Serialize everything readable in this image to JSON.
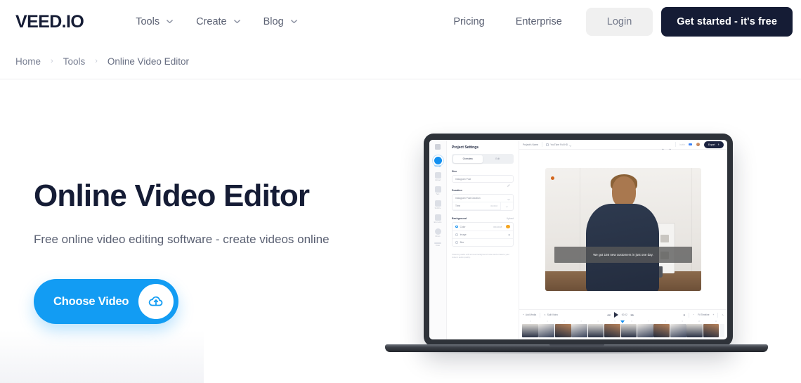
{
  "brand": {
    "logo": "VEED.IO",
    "navy": "#151c35",
    "blue": "#129cf3"
  },
  "header": {
    "nav": [
      {
        "label": "Tools",
        "icon": "chevron-down-icon"
      },
      {
        "label": "Create",
        "icon": "chevron-down-icon"
      },
      {
        "label": "Blog",
        "icon": "chevron-down-icon"
      }
    ],
    "links": [
      {
        "label": "Pricing"
      },
      {
        "label": "Enterprise"
      }
    ],
    "login_label": "Login",
    "cta_label": "Get started - it's free"
  },
  "breadcrumb": {
    "separator": "›",
    "items": [
      {
        "label": "Home"
      },
      {
        "label": "Tools"
      },
      {
        "label": "Online Video Editor"
      }
    ]
  },
  "hero": {
    "title": "Online Video Editor",
    "subtitle": "Free online video editing software - create videos online",
    "cta_label": "Choose Video",
    "cta_icon": "cloud-upload-icon"
  },
  "editor": {
    "rail": [
      {
        "label": "Settings",
        "active": true
      },
      {
        "label": "Upload",
        "active": false
      },
      {
        "label": "Text",
        "active": false
      },
      {
        "label": "Subtitle",
        "active": false
      },
      {
        "label": "Elements",
        "active": false
      },
      {
        "label": "Filters",
        "active": false
      },
      {
        "label": "Draw",
        "active": false
      }
    ],
    "panel": {
      "title": "Project Settings",
      "tabs": [
        {
          "label": "Overview",
          "active": true
        },
        {
          "label": "Edit",
          "active": false
        }
      ],
      "size": {
        "label": "Size",
        "value": "Instagram Post",
        "icon": "pencil-icon"
      },
      "duration": {
        "label": "Duration",
        "preset": "Instagram Post Duration",
        "time_label": "Time",
        "time_value": "01:00.0",
        "stepper": "+/-"
      },
      "background": {
        "label": "Background",
        "upload_label": "Upload",
        "options": [
          {
            "label": "Color",
            "selected": true,
            "value": "#0C2D48",
            "swatch": "#f5a623"
          },
          {
            "label": "Image",
            "selected": false
          },
          {
            "label": "Blur",
            "selected": false
          }
        ]
      },
      "note": "Cleaning audio will remove background noise and enhance your video's audio quality."
    },
    "topbar": {
      "project_name": "Project's Name",
      "preset": "YouTube Full HD",
      "undo_icon": "undo-icon",
      "redo_icon": "redo-icon",
      "invite_label": "Invite",
      "avatar": "user-avatar",
      "export_label": "Export"
    },
    "stage": {
      "caption": "We got 156 new customers in just one day."
    },
    "controls": {
      "add_media": "Add Media",
      "split_video": "Split Video",
      "time": "00:02",
      "zoom_label": "Fit Timeline",
      "ticks": [
        "0",
        "1",
        "2",
        "3",
        "4",
        "5",
        "6",
        "7",
        "8",
        "9",
        "10",
        "11"
      ]
    }
  }
}
